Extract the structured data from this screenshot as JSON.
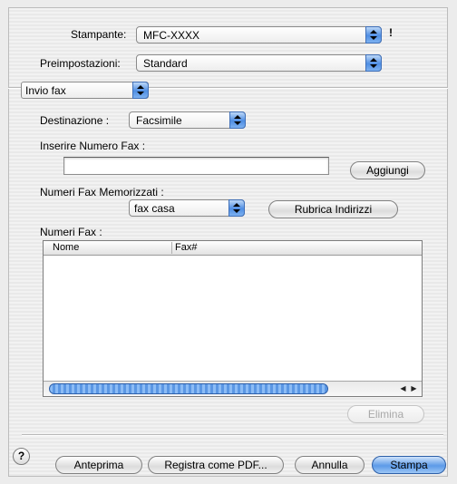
{
  "printer": {
    "label": "Stampante:",
    "value": "MFC-XXXX"
  },
  "presets": {
    "label": "Preimpostazioni:",
    "value": "Standard"
  },
  "panel": {
    "value": "Invio fax"
  },
  "destination": {
    "label": "Destinazione :",
    "value": "Facsimile"
  },
  "fax_number": {
    "label": "Inserire Numero Fax :",
    "value": "",
    "add_button": "Aggiungi"
  },
  "stored": {
    "label": "Numeri Fax Memorizzati :",
    "value": "fax casa",
    "address_book_button": "Rubrica Indirizzi"
  },
  "fax_list": {
    "label": "Numeri Fax :",
    "columns": [
      "Nome",
      "Fax#"
    ],
    "rows": []
  },
  "delete_button": "Elimina",
  "footer": {
    "help": "?",
    "preview": "Anteprima",
    "save_pdf": "Registra come PDF...",
    "cancel": "Annulla",
    "print": "Stampa"
  },
  "icons": {
    "warning": "!"
  },
  "colors": {
    "accent": "#5c9ae8",
    "scroll_thumb": "#8cbcf5"
  }
}
